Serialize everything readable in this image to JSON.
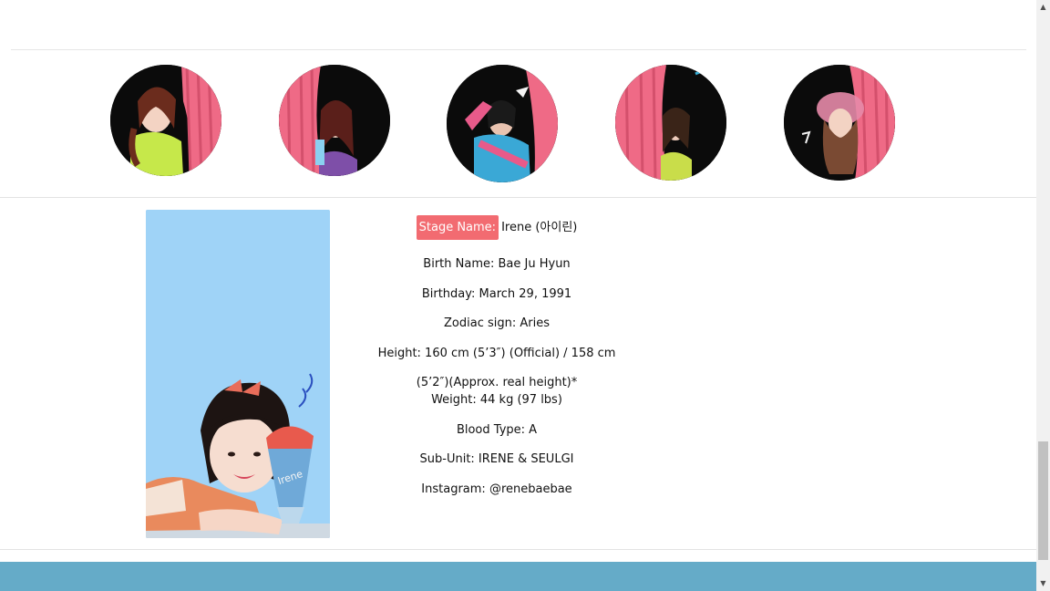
{
  "members": [
    {
      "name": "member-avatar-irene"
    },
    {
      "name": "member-avatar-joy"
    },
    {
      "name": "member-avatar-seulgi"
    },
    {
      "name": "member-avatar-wendy"
    },
    {
      "name": "member-avatar-yeri"
    }
  ],
  "profile": {
    "stage_label": "Stage Name:",
    "stage_value": "Irene (아이린)",
    "birth_name": "Birth Name: Bae Ju Hyun",
    "birthday": "Birthday: March 29, 1991",
    "zodiac": "Zodiac sign: Aries",
    "height": "Height: 160 cm (5’3″) (Official) / 158 cm",
    "height_cont": "(5’2″)(Approx. real height)*",
    "weight": "Weight: 44 kg (97 lbs)",
    "blood_type": "Blood Type: A",
    "sub_unit": "Sub-Unit: IRENE & SEULGI",
    "instagram": "Instagram: @renebaebae"
  },
  "colors": {
    "badge": "#f26b71",
    "footer": "#65abc8",
    "photo_bg": "#9fd3f7",
    "curtain": "#f06a85"
  },
  "scrollbar": {
    "up_icon": "▲",
    "down_icon": "▼"
  }
}
